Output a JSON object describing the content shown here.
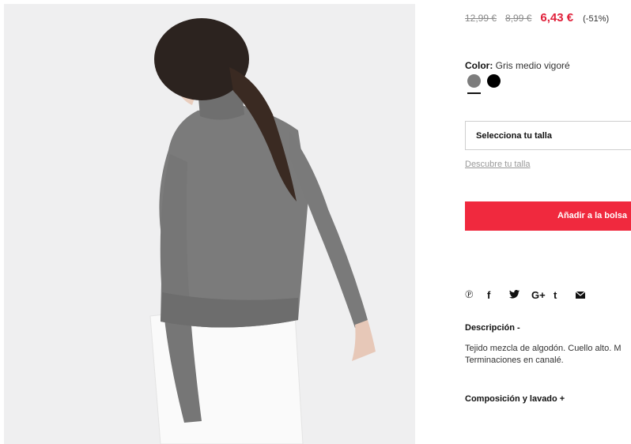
{
  "product": {
    "image_alt": "Jersey cuello alto gris",
    "price_original": "12,99 €",
    "price_previous": "8,99 €",
    "price_current": "6,43 €",
    "discount": "(-51%)",
    "color_label": "Color:",
    "color_value": "Gris medio vigoré",
    "colors": [
      {
        "name": "Gris medio vigoré",
        "hex": "#7d7d7d",
        "selected": true
      },
      {
        "name": "Negro",
        "hex": "#000000",
        "selected": false
      }
    ],
    "size_placeholder": "Selecciona tu talla",
    "size_guide": "Descubre tu talla",
    "add_to_bag": "Añadir a la bolsa",
    "share_icons": [
      "pinterest-icon",
      "facebook-icon",
      "twitter-icon",
      "google-plus-icon",
      "tumblr-icon",
      "email-icon"
    ],
    "description_title": "Descripción -",
    "description_lines": [
      "Tejido mezcla de algodón. Cuello alto. M",
      "Terminaciones en canalé."
    ],
    "composition_title": "Composición y lavado +"
  },
  "colors": {
    "sale_price": "#e0203a",
    "add_button": "#f0293e",
    "image_background": "#efeff0"
  }
}
